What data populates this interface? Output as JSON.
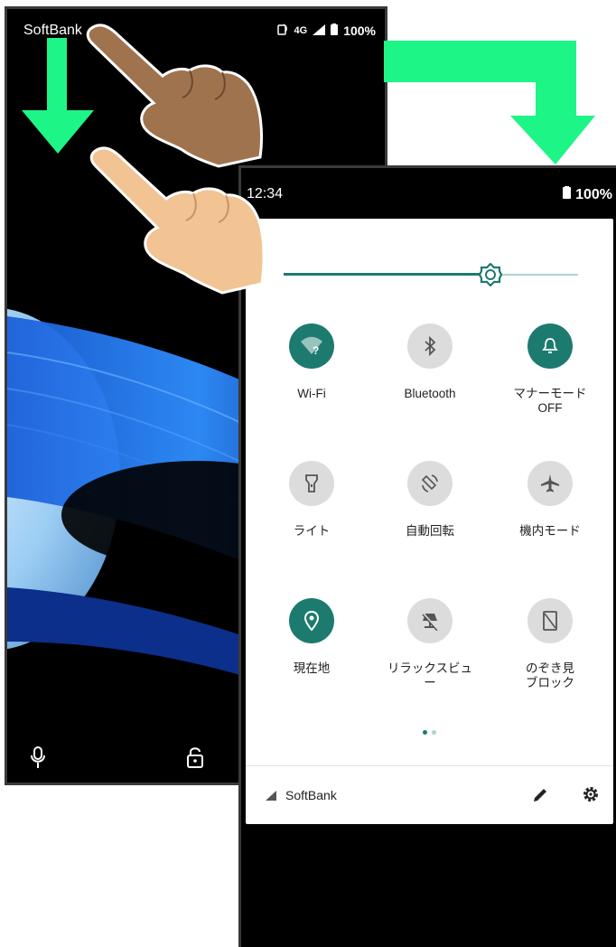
{
  "lock_screen": {
    "carrier": "SoftBank",
    "network": "4G",
    "battery": "100%"
  },
  "quick_settings": {
    "time": "12:34",
    "battery": "100%",
    "brightness": 0.7,
    "tiles": [
      {
        "label": "Wi-Fi",
        "sub": "",
        "state": "on",
        "icon": "wifi-icon"
      },
      {
        "label": "Bluetooth",
        "sub": "",
        "state": "off",
        "icon": "bluetooth-icon"
      },
      {
        "label": "マナーモード",
        "sub": "OFF",
        "state": "on",
        "icon": "bell-icon"
      },
      {
        "label": "ライト",
        "sub": "",
        "state": "off",
        "icon": "flashlight-icon"
      },
      {
        "label": "自動回転",
        "sub": "",
        "state": "off",
        "icon": "auto-rotate-icon"
      },
      {
        "label": "機内モード",
        "sub": "",
        "state": "off",
        "icon": "airplane-icon"
      },
      {
        "label": "現在地",
        "sub": "",
        "state": "on",
        "icon": "location-icon"
      },
      {
        "label": "リラックスビュ",
        "sub": "ー",
        "state": "off",
        "icon": "relax-view-icon"
      },
      {
        "label": "のぞき見",
        "sub": "ブロック",
        "state": "off",
        "icon": "peep-block-icon"
      }
    ],
    "page_indicator": {
      "pages": 2,
      "current": 1
    },
    "footer": {
      "carrier": "SoftBank"
    }
  },
  "colors": {
    "accent": "#1d7a6e",
    "arrow": "#1ef587",
    "tile_off": "#dcdcdc"
  }
}
